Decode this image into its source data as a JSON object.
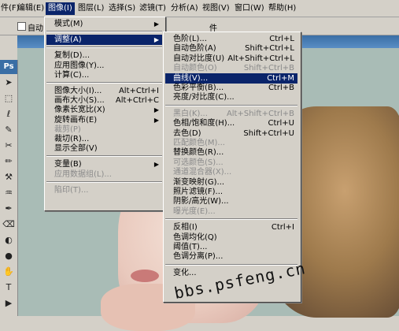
{
  "menubar": [
    {
      "label": "件(F)",
      "x": 0,
      "active": false
    },
    {
      "label": "编辑(E)",
      "x": 1,
      "active": false
    },
    {
      "label": "图像(I)",
      "x": 2,
      "active": true
    },
    {
      "label": "图层(L)",
      "x": 3,
      "active": false
    },
    {
      "label": "选择(S)",
      "x": 4,
      "active": false
    },
    {
      "label": "滤镜(T)",
      "x": 5,
      "active": false
    },
    {
      "label": "分析(A)",
      "x": 6,
      "active": false
    },
    {
      "label": "视图(V)",
      "x": 7,
      "active": false
    },
    {
      "label": "窗口(W)",
      "x": 8,
      "active": false
    },
    {
      "label": "帮助(H)",
      "x": 9,
      "active": false
    }
  ],
  "options": {
    "auto_label": "自动",
    "right_label": "件"
  },
  "image_menu": [
    {
      "label": "模式(M)",
      "type": "submenu"
    },
    {
      "type": "sep"
    },
    {
      "label": "调整(A)",
      "type": "submenu",
      "highlight": true
    },
    {
      "type": "sep"
    },
    {
      "label": "复制(D)...",
      "type": "item"
    },
    {
      "label": "应用图像(Y)...",
      "type": "item"
    },
    {
      "label": "计算(C)...",
      "type": "item"
    },
    {
      "type": "sep"
    },
    {
      "label": "图像大小(I)...",
      "shortcut": "Alt+Ctrl+I",
      "type": "item"
    },
    {
      "label": "画布大小(S)...",
      "shortcut": "Alt+Ctrl+C",
      "type": "item"
    },
    {
      "label": "像素长宽比(X)",
      "type": "submenu"
    },
    {
      "label": "旋转画布(E)",
      "type": "submenu"
    },
    {
      "label": "裁剪(P)",
      "type": "item",
      "disabled": true
    },
    {
      "label": "裁切(R)...",
      "type": "item"
    },
    {
      "label": "显示全部(V)",
      "type": "item"
    },
    {
      "type": "sep"
    },
    {
      "label": "变量(B)",
      "type": "submenu"
    },
    {
      "label": "应用数据组(L)...",
      "type": "item",
      "disabled": true
    },
    {
      "type": "sep"
    },
    {
      "label": "陷印(T)...",
      "type": "item",
      "disabled": true
    }
  ],
  "adjust_menu": [
    {
      "label": "色阶(L)...",
      "shortcut": "Ctrl+L"
    },
    {
      "label": "自动色阶(A)",
      "shortcut": "Shift+Ctrl+L"
    },
    {
      "label": "自动对比度(U)",
      "shortcut": "Alt+Shift+Ctrl+L"
    },
    {
      "label": "自动颜色(O)",
      "shortcut": "Shift+Ctrl+B",
      "disabled": true
    },
    {
      "label": "曲线(V)...",
      "shortcut": "Ctrl+M",
      "highlight": true
    },
    {
      "label": "色彩平衡(B)...",
      "shortcut": "Ctrl+B"
    },
    {
      "label": "亮度/对比度(C)..."
    },
    {
      "type": "sep"
    },
    {
      "label": "黑白(K)...",
      "shortcut": "Alt+Shift+Ctrl+B",
      "disabled": true
    },
    {
      "label": "色相/饱和度(H)...",
      "shortcut": "Ctrl+U"
    },
    {
      "label": "去色(D)",
      "shortcut": "Shift+Ctrl+U"
    },
    {
      "label": "匹配颜色(M)...",
      "disabled": true
    },
    {
      "label": "替换颜色(R)..."
    },
    {
      "label": "可选颜色(S)...",
      "disabled": true
    },
    {
      "label": "通道混合器(X)...",
      "disabled": true
    },
    {
      "label": "渐变映射(G)..."
    },
    {
      "label": "照片滤镜(F)..."
    },
    {
      "label": "阴影/高光(W)..."
    },
    {
      "label": "曝光度(E)...",
      "disabled": true
    },
    {
      "type": "sep"
    },
    {
      "label": "反相(I)",
      "shortcut": "Ctrl+I"
    },
    {
      "label": "色调均化(Q)"
    },
    {
      "label": "阈值(T)..."
    },
    {
      "label": "色调分离(P)..."
    },
    {
      "type": "sep"
    },
    {
      "label": "变化..."
    }
  ],
  "toolbox": {
    "logo": "Ps"
  },
  "watermark": "bbs.psfeng.cn",
  "colors": {
    "highlight": "#0a246a",
    "menu_bg": "#d4d0c8",
    "disabled": "#8a8a8a"
  }
}
